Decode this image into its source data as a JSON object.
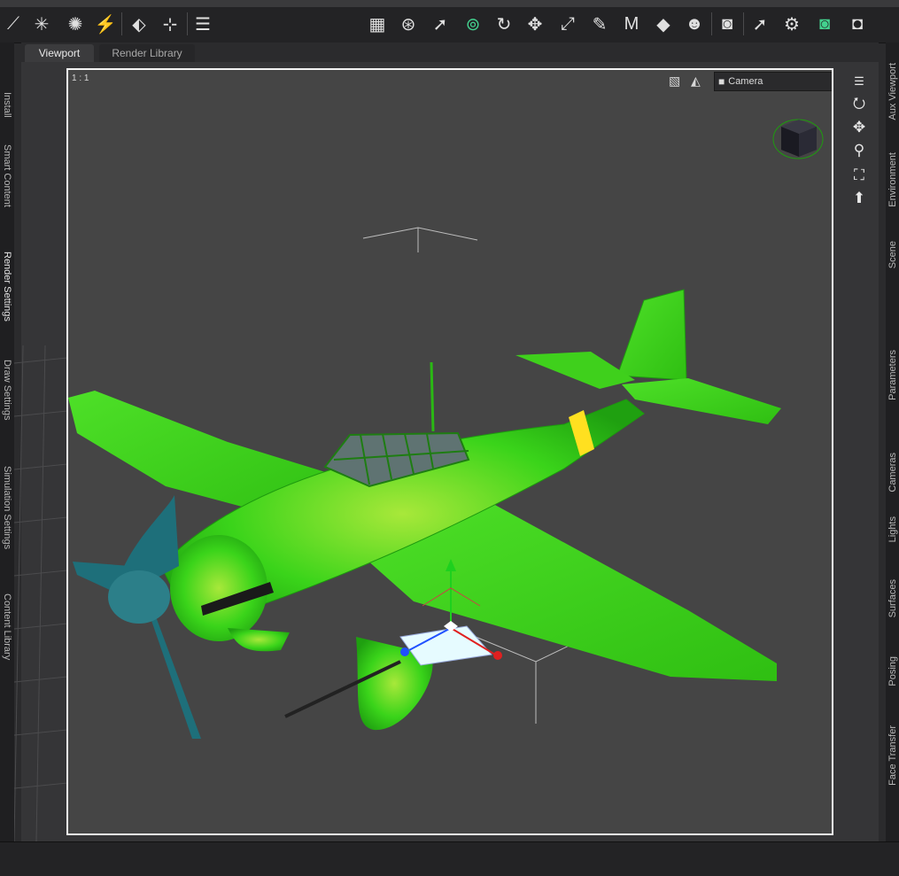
{
  "toolbar": {
    "icons": [
      "wand-tool-icon",
      "spotlight-icon",
      "point-light-icon",
      "distant-light-icon",
      "add-node-icon",
      "add-null-icon",
      "align-icon",
      "grid-icon",
      "universal-tool-icon",
      "node-selection-icon",
      "active-pose-icon",
      "rotate-icon",
      "translate-icon",
      "scale-icon",
      "joint-editor-icon",
      "geometry-editor-icon",
      "surface-selection-icon",
      "figure-setup-icon",
      "render-settings-icon",
      "spot-render-icon",
      "iray-icon",
      "camera-render-icon",
      "render-icon"
    ]
  },
  "left_tabs": [
    "Install",
    "Smart Content",
    "Render Settings",
    "Draw Settings",
    "Simulation Settings",
    "Content Library"
  ],
  "right_tabs": [
    "Aux Viewport",
    "Environment",
    "Scene",
    "Parameters",
    "Cameras",
    "Lights",
    "Surfaces",
    "Posing",
    "Face Transfer"
  ],
  "panel_tabs": {
    "viewport": "Viewport",
    "render_library": "Render Library"
  },
  "viewport": {
    "aspect_label": "1 : 1",
    "camera_label": "Camera",
    "model_color": "#35d21a",
    "band_color": "#ffe020",
    "prop_color": "#1e6f7a"
  }
}
